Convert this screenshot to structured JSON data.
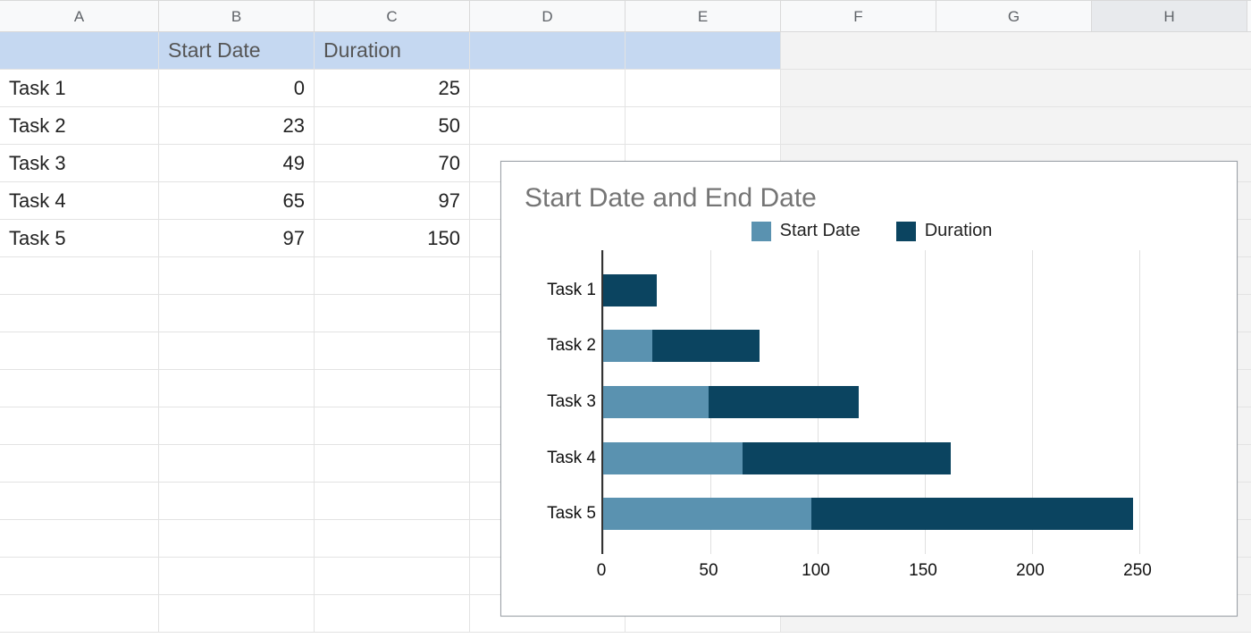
{
  "columns": [
    "A",
    "B",
    "C",
    "D",
    "E",
    "F",
    "G",
    "H"
  ],
  "table": {
    "headers": {
      "A": "",
      "B": "Start Date",
      "C": "Duration"
    },
    "rows": [
      {
        "label": "Task 1",
        "start": 0,
        "duration": 25
      },
      {
        "label": "Task 2",
        "start": 23,
        "duration": 50
      },
      {
        "label": "Task 3",
        "start": 49,
        "duration": 70
      },
      {
        "label": "Task 4",
        "start": 65,
        "duration": 97
      },
      {
        "label": "Task 5",
        "start": 97,
        "duration": 150
      }
    ]
  },
  "chart_data": {
    "type": "bar",
    "orientation": "horizontal",
    "stacked": true,
    "title": "Start Date and End Date",
    "categories": [
      "Task 1",
      "Task 2",
      "Task 3",
      "Task 4",
      "Task 5"
    ],
    "series": [
      {
        "name": "Start Date",
        "color": "#5a92b0",
        "values": [
          0,
          23,
          49,
          65,
          97
        ]
      },
      {
        "name": "Duration",
        "color": "#0b4460",
        "values": [
          25,
          50,
          70,
          97,
          150
        ]
      }
    ],
    "xlabel": "",
    "ylabel": "",
    "xlim": [
      0,
      250
    ],
    "x_ticks": [
      0,
      50,
      100,
      150,
      200,
      250
    ],
    "legend_position": "top"
  }
}
